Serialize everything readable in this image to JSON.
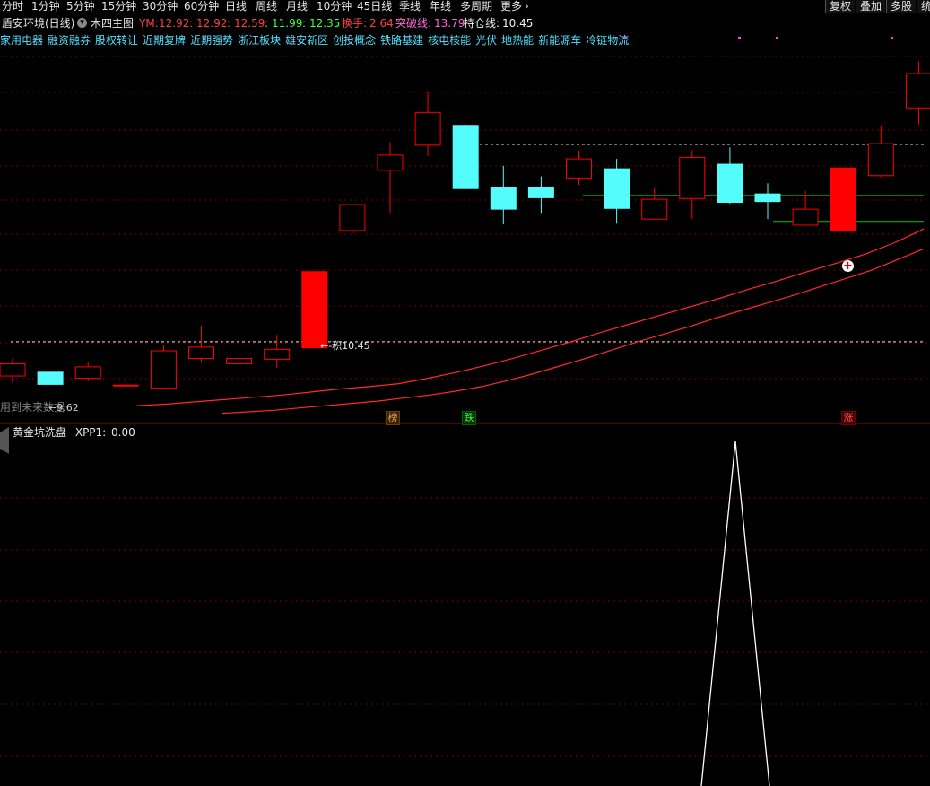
{
  "toolbar": {
    "periods": [
      "分时",
      "1分钟",
      "5分钟",
      "15分钟",
      "30分钟",
      "60分钟",
      "日线",
      "周线",
      "月线",
      "10分钟",
      "45日线",
      "季线",
      "年线",
      "多周期",
      "更多"
    ],
    "more_arrow": "›",
    "right_buttons": [
      "复权",
      "叠加",
      "多股",
      "统"
    ]
  },
  "info": {
    "stock_title": "盾安环境(日线)",
    "indicator_name": "木四主图",
    "ym_label": "YM:",
    "ym_values": [
      "12.92",
      "12.92",
      "12.59",
      "11.99",
      "12.35"
    ],
    "turnover_label": "换手:",
    "turnover_value": "2.64",
    "breakout_label": "突破线:",
    "breakout_value": "13.79",
    "hold_label": "持仓线:",
    "hold_value": "10.45"
  },
  "sectors": [
    "家用电器",
    "融资融券",
    "股权转让",
    "近期复牌",
    "近期强势",
    "浙江板块",
    "雄安新区",
    "创投概念",
    "铁路基建",
    "核电核能",
    "光伏",
    "地热能",
    "新能源车",
    "冷链物流"
  ],
  "main_chart": {
    "hold_line_label": "←-积10.45",
    "low_label": "←9.62",
    "future_data_note": "用到未来数据",
    "signals": [
      {
        "text": "榜",
        "color": "#e0a060"
      },
      {
        "text": "跌",
        "color": "#40ff40"
      },
      {
        "text": "涨",
        "color": "#ff5050"
      }
    ],
    "plus_marker": "+",
    "colors": {
      "up": "#ff0000",
      "down": "#54fcfc",
      "ma": "#ff2a2a",
      "green_line": "#00c800",
      "grid": "#7a0000"
    }
  },
  "indicator": {
    "name": "黄金坑洗盘",
    "value_label": "XPP1:",
    "value": "0.00"
  },
  "chart_data": {
    "type": "candlestick",
    "price_range": [
      9.4,
      14.3
    ],
    "candles": [
      {
        "o": 10.0,
        "c": 10.16,
        "h": 10.23,
        "l": 9.91
      },
      {
        "o": 10.05,
        "c": 9.89,
        "h": 10.05,
        "l": 9.89
      },
      {
        "o": 9.97,
        "c": 10.12,
        "h": 10.19,
        "l": 9.93
      },
      {
        "o": 9.88,
        "c": 9.88,
        "h": 9.96,
        "l": 9.86
      },
      {
        "o": 9.84,
        "c": 10.33,
        "h": 10.4,
        "l": 9.84
      },
      {
        "o": 10.23,
        "c": 10.38,
        "h": 10.66,
        "l": 10.18
      },
      {
        "o": 10.16,
        "c": 10.23,
        "h": 10.26,
        "l": 10.15
      },
      {
        "o": 10.22,
        "c": 10.35,
        "h": 10.54,
        "l": 10.11
      },
      {
        "o": 10.37,
        "c": 11.37,
        "h": 11.37,
        "l": 10.37
      },
      {
        "o": 11.91,
        "c": 12.25,
        "h": 12.25,
        "l": 11.87
      },
      {
        "o": 12.7,
        "c": 12.9,
        "h": 13.07,
        "l": 12.14
      },
      {
        "o": 13.03,
        "c": 13.46,
        "h": 13.74,
        "l": 12.89
      },
      {
        "o": 13.29,
        "c": 12.46,
        "h": 13.3,
        "l": 12.46
      },
      {
        "o": 12.48,
        "c": 12.19,
        "h": 12.76,
        "l": 11.99
      },
      {
        "o": 12.48,
        "c": 12.34,
        "h": 12.62,
        "l": 12.14
      },
      {
        "o": 12.6,
        "c": 12.85,
        "h": 12.96,
        "l": 12.51
      },
      {
        "o": 12.72,
        "c": 12.2,
        "h": 12.85,
        "l": 12.0
      },
      {
        "o": 12.06,
        "c": 12.32,
        "h": 12.48,
        "l": 12.06
      },
      {
        "o": 12.33,
        "c": 12.87,
        "h": 12.96,
        "l": 12.06
      },
      {
        "o": 12.78,
        "c": 12.28,
        "h": 13.0,
        "l": 12.26
      },
      {
        "o": 12.39,
        "c": 12.29,
        "h": 12.53,
        "l": 12.06
      },
      {
        "o": 11.98,
        "c": 12.19,
        "h": 12.43,
        "l": 11.98
      },
      {
        "o": 11.91,
        "c": 12.73,
        "h": 12.73,
        "l": 11.91
      },
      {
        "o": 12.63,
        "c": 13.05,
        "h": 13.29,
        "l": 12.61
      },
      {
        "o": 13.52,
        "c": 13.97,
        "h": 14.13,
        "l": 13.3
      }
    ],
    "ma_lines": [
      {
        "values": [
          9.61,
          9.63,
          9.66,
          9.69,
          9.72,
          9.75,
          9.79,
          9.83,
          9.86,
          9.9,
          9.97,
          10.05,
          10.14,
          10.24,
          10.35,
          10.46,
          10.58,
          10.69,
          10.8,
          10.91,
          11.02,
          11.14,
          11.25,
          11.37,
          11.48,
          11.6,
          11.75,
          11.93
        ]
      },
      {
        "values": [
          9.51,
          9.53,
          9.55,
          9.58,
          9.61,
          9.64,
          9.67,
          9.71,
          9.75,
          9.8,
          9.86,
          9.94,
          10.03,
          10.13,
          10.23,
          10.34,
          10.45,
          10.55,
          10.65,
          10.76,
          10.86,
          10.96,
          11.06,
          11.17,
          11.28,
          11.39,
          11.53,
          11.67
        ]
      }
    ],
    "hold_line": 10.45,
    "breakout_line": 13.04,
    "green_lines": [
      12.37,
      12.03
    ],
    "indicator_series": [
      {
        "name": "XPP1",
        "x": [
          19.3,
          19.75,
          20.2
        ],
        "values": [
          0.28,
          1.0,
          0.28
        ]
      }
    ],
    "indicator_range": [
      0,
      1
    ]
  }
}
